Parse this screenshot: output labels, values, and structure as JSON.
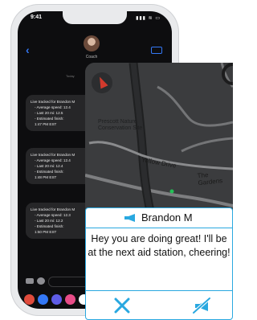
{
  "status_bar": {
    "time": "9:41",
    "icons": "▮▮▮ ≋ ▭"
  },
  "conversation": {
    "contact": "Coach",
    "day_label": "Today"
  },
  "bubbles": [
    {
      "lines": [
        "Live tracked for Brandon M",
        "- Average speed: 12.4",
        "- Last 20 mi: 12.5",
        "- Estimated finish:",
        "1:47 PM EST"
      ]
    },
    {
      "lines": [
        "Live tracked for Brandon M",
        "- Average speed: 12.4",
        "- Last 20 mi: 12.4",
        "- Estimated finish:",
        "1:48 PM EST"
      ]
    },
    {
      "lines": [
        "Live tracked for Brandon M",
        "- Average speed: 12.3",
        "- Last 20 mi: 12.2",
        "- Estimated finish:",
        "1:50 PM EST"
      ]
    }
  ],
  "map": {
    "poi_label": "Prescott Nature Conservation Site",
    "streets": [
      "Yellow Drive",
      "The Gardens"
    ]
  },
  "notification": {
    "sender": "Brandon M",
    "message": "Hey you are doing great! I'll be at the next aid station, cheering!"
  },
  "colors": {
    "accent": "#29a8e0",
    "ios_blue": "#3478f6"
  }
}
